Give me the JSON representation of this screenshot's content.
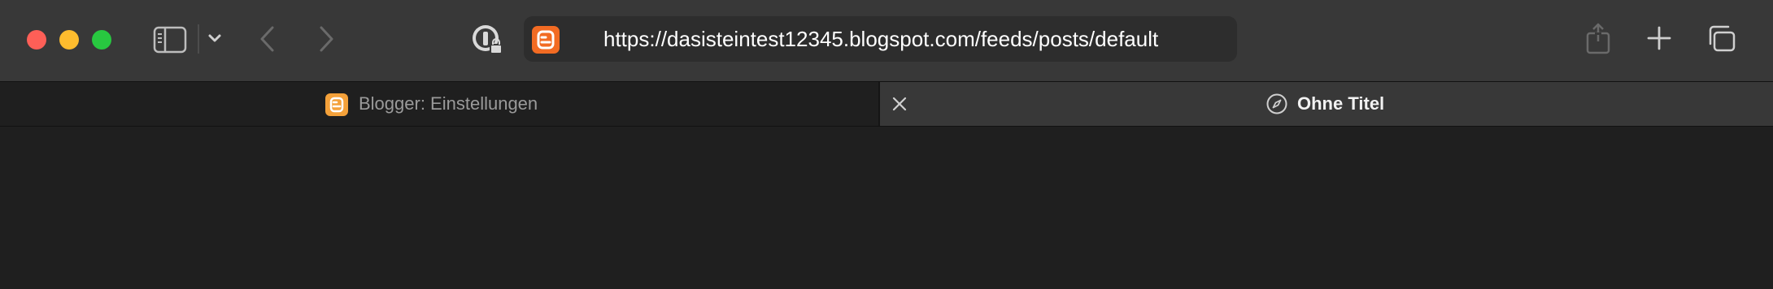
{
  "window": {
    "traffic_lights": {
      "close_color": "#fe5f57",
      "minimize_color": "#febc2e",
      "maximize_color": "#28c840"
    }
  },
  "toolbar": {
    "icons": {
      "sidebar": "sidebar-icon",
      "chevron": "chevron-down-icon",
      "back": "chevron-left-icon",
      "forward": "chevron-right-icon",
      "password": "password-lock-icon",
      "share": "share-icon",
      "new_tab": "plus-icon",
      "tab_overview": "tab-overview-icon"
    }
  },
  "address_bar": {
    "url": "https://dasisteintest12345.blogspot.com/feeds/posts/default",
    "favicon": "blogger-icon",
    "favicon_color": "#f26b23"
  },
  "tabs": [
    {
      "title": "Blogger: Einstellungen",
      "favicon": "blogger-icon",
      "favicon_color": "#f4a13a",
      "active": false
    },
    {
      "title": "Ohne Titel",
      "favicon": "compass-icon",
      "active": true
    }
  ]
}
